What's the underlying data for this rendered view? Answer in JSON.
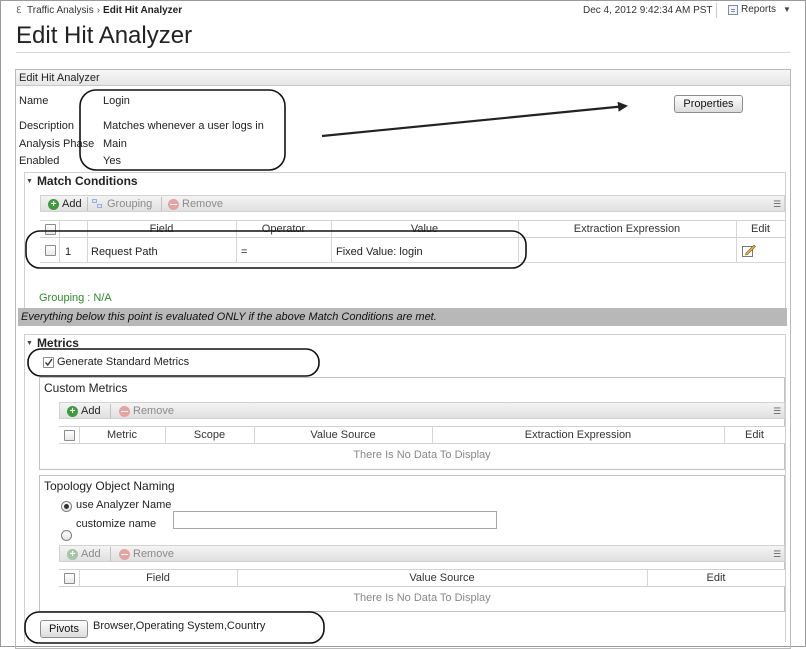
{
  "breadcrumb": {
    "parent": "Traffic Analysis",
    "current": "Edit Hit Analyzer"
  },
  "header": {
    "datetime": "Dec 4, 2012 9:42:34 AM PST",
    "reports_label": "Reports"
  },
  "page_title": "Edit Hit Analyzer",
  "panel": {
    "title": "Edit Hit Analyzer",
    "properties_button": "Properties",
    "fields": [
      {
        "label": "Name",
        "value": "Login"
      },
      {
        "label": "Description",
        "value": "Matches whenever a user logs in"
      },
      {
        "label": "Analysis Phase",
        "value": "Main"
      },
      {
        "label": "Enabled",
        "value": "Yes"
      }
    ]
  },
  "match_conditions": {
    "title": "Match Conditions",
    "toolbar": {
      "add": "Add",
      "grouping": "Grouping",
      "remove": "Remove"
    },
    "columns": [
      "Field",
      "Operator",
      "Value",
      "Extraction Expression",
      "Edit"
    ],
    "rows": [
      {
        "index": "1",
        "field": "Request Path",
        "operator": "=",
        "value": "Fixed Value: login",
        "extraction": ""
      }
    ],
    "grouping": "Grouping : N/A"
  },
  "notice": "Everything below this point is evaluated ONLY if the above Match Conditions are met.",
  "metrics": {
    "title": "Metrics",
    "generate_standard": {
      "label": "Generate Standard Metrics",
      "checked": true
    },
    "custom": {
      "title": "Custom Metrics",
      "toolbar": {
        "add": "Add",
        "remove": "Remove"
      },
      "columns": [
        "Metric",
        "Scope",
        "Value Source",
        "Extraction Expression",
        "Edit"
      ],
      "empty": "There Is No Data To Display"
    },
    "topology": {
      "title": "Topology Object Naming",
      "option_analyzer": "use Analyzer Name",
      "option_customize": "customize name",
      "customize_value": "",
      "toolbar": {
        "add": "Add",
        "remove": "Remove"
      },
      "columns": [
        "Field",
        "Value Source",
        "Edit"
      ],
      "empty": "There Is No Data To Display"
    },
    "pivots": {
      "button": "Pivots",
      "value": "Browser,Operating System,Country"
    }
  },
  "colors": {
    "grouping_text": "#2e8b2e",
    "notice_band": "#b8b8b8",
    "add_icon": "#3f9a3f",
    "remove_icon": "#e5a3a3"
  }
}
